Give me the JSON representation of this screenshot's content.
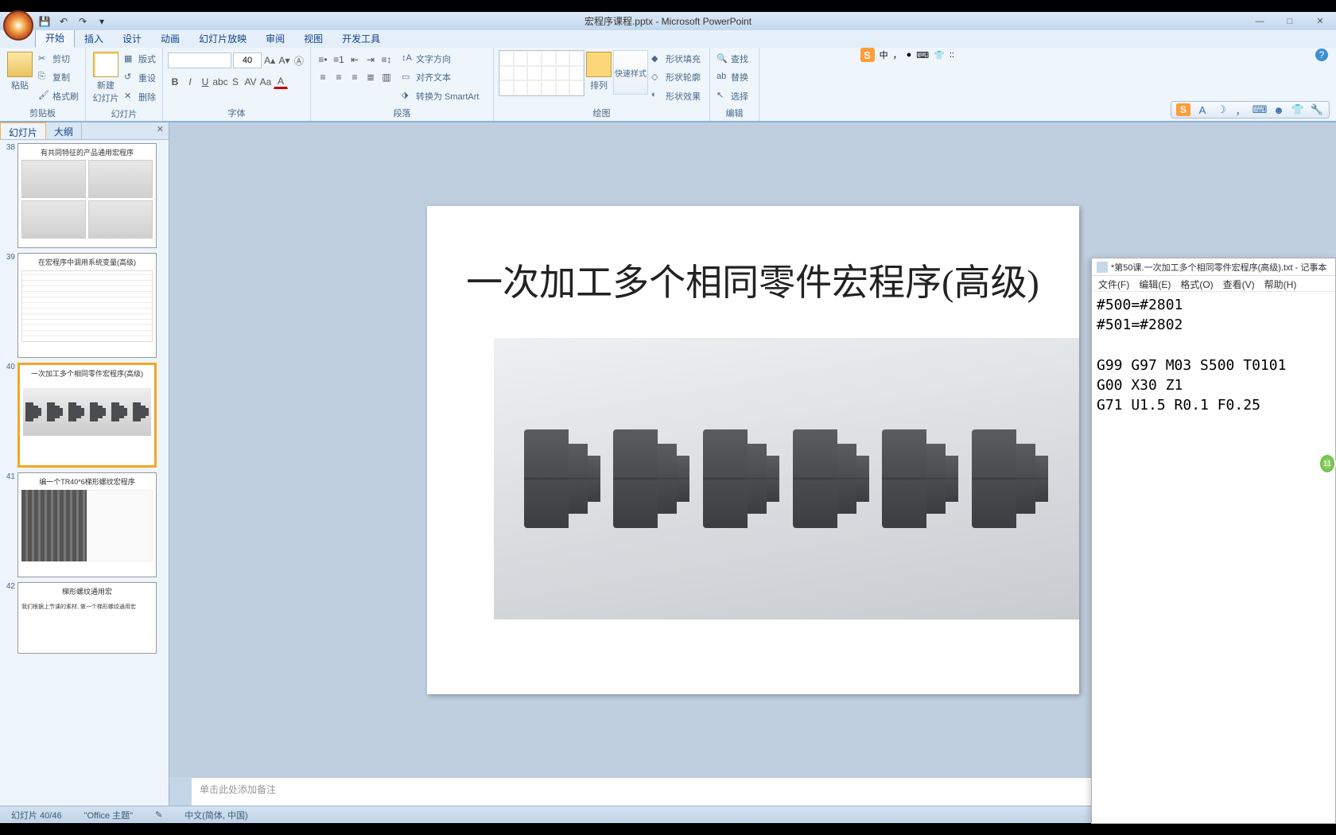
{
  "titleBar": {
    "docName": "宏程序课程.pptx - Microsoft PowerPoint"
  },
  "winControls": {
    "min": "—",
    "max": "□",
    "close": "✕"
  },
  "ribbonTabs": [
    "开始",
    "插入",
    "设计",
    "动画",
    "幻灯片放映",
    "审阅",
    "视图",
    "开发工具"
  ],
  "langBar": {
    "badge": "S",
    "mode": "中",
    "icons": [
      "，",
      "●",
      "⌨",
      "👕",
      "::"
    ]
  },
  "ribbon": {
    "clipboard": {
      "paste": "粘贴",
      "cut": "剪切",
      "copy": "复制",
      "painter": "格式刷",
      "label": "剪贴板"
    },
    "slides": {
      "newSlide": "新建\n幻灯片",
      "layout": "版式",
      "reset": "重设",
      "delete": "删除",
      "label": "幻灯片"
    },
    "font": {
      "size": "40",
      "label": "字体"
    },
    "paragraph": {
      "dir": "文字方向",
      "align": "对齐文本",
      "smartart": "转换为 SmartArt",
      "label": "段落"
    },
    "drawing": {
      "arrange": "排列",
      "quickStyle": "快速样式",
      "fill": "形状填充",
      "outline": "形状轮廓",
      "effects": "形状效果",
      "label": "绘图"
    },
    "editing": {
      "find": "查找",
      "replace": "替换",
      "select": "选择",
      "label": "编辑"
    }
  },
  "panelTabs": {
    "slides": "幻灯片",
    "outline": "大纲"
  },
  "thumbs": [
    {
      "num": "38",
      "title": "有共同特征的产品通用宏程序"
    },
    {
      "num": "39",
      "title": "在宏程序中调用系统变量(高级)"
    },
    {
      "num": "40",
      "title": "一次加工多个相同零件宏程序(高级)"
    },
    {
      "num": "41",
      "title": "编一个TR40*6梯形螺纹宏程序"
    },
    {
      "num": "42",
      "title": "梯形螺纹通用宏",
      "sub": "我们根据上节课的素材, 做一个梯形螺纹通用宏"
    }
  ],
  "slide": {
    "title": "一次加工多个相同零件宏程序(高级)"
  },
  "notesPlaceholder": "单击此处添加备注",
  "statusBar": {
    "slidePos": "幻灯片 40/46",
    "theme": "\"Office 主题\"",
    "lang": "中文(简体, 中国)"
  },
  "notepad": {
    "title": "*第50课.一次加工多个相同零件宏程序(高级).txt - 记事本",
    "menus": {
      "file": "文件(F)",
      "edit": "编辑(E)",
      "format": "格式(O)",
      "view": "查看(V)",
      "help": "帮助(H)"
    },
    "content": "#500=#2801\n#501=#2802\n\nG99 G97 M03 S500 T0101\nG00 X30 Z1\nG71 U1.5 R0.1 F0.25"
  },
  "sideBadge": "11"
}
